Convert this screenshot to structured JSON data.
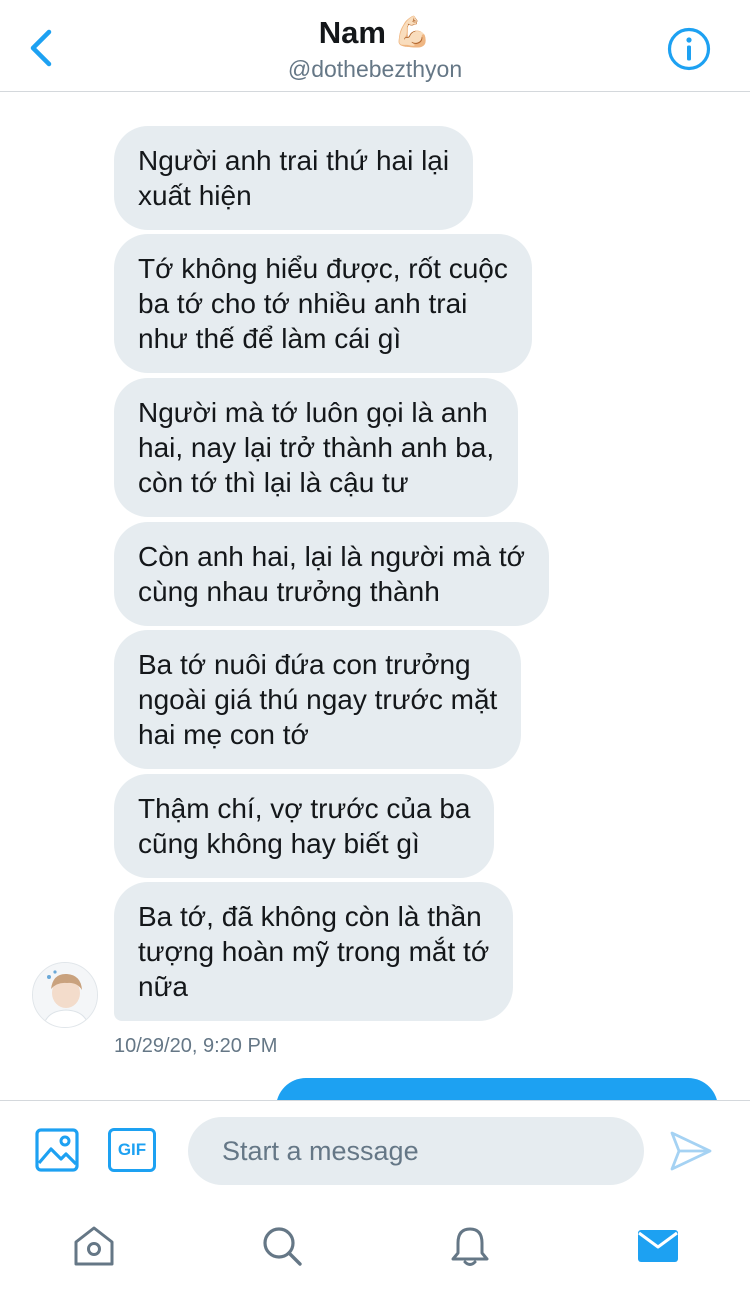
{
  "header": {
    "name": "Nam",
    "name_emoji": "💪🏻",
    "handle": "@dothebezthyon"
  },
  "messages": [
    "Người anh trai thứ hai lại\nxuất hiện",
    "Tớ không hiểu được, rốt cuộc\nba tớ cho tớ nhiều anh trai\nnhư thế để làm cái gì",
    "Người mà tớ luôn gọi là anh\nhai, nay lại trở thành anh ba,\ncòn tớ thì lại là cậu tư",
    "Còn anh hai, lại là người mà tớ\ncùng nhau trưởng thành",
    "Ba tớ nuôi đứa con trưởng\nngoài giá thú ngay trước mặt\nhai mẹ con tớ",
    "Thậm chí, vợ trước của ba\ncũng không hay biết gì",
    "Ba tớ, đã không còn là thần\ntượng hoàn mỹ trong mắt tớ\nnữa"
  ],
  "timestamp": "10/29/20, 9:20 PM",
  "composer": {
    "gif_label": "GIF",
    "placeholder": "Start a message"
  },
  "colors": {
    "accent": "#1da1f2",
    "bubble": "#e6ecf0",
    "secondary_text": "#657786"
  },
  "icons": {
    "back": "chevron-left-icon",
    "info": "info-icon",
    "media": "image-icon",
    "send": "send-icon",
    "home": "home-icon",
    "search": "search-icon",
    "notifications": "bell-icon",
    "messages": "mail-icon"
  }
}
